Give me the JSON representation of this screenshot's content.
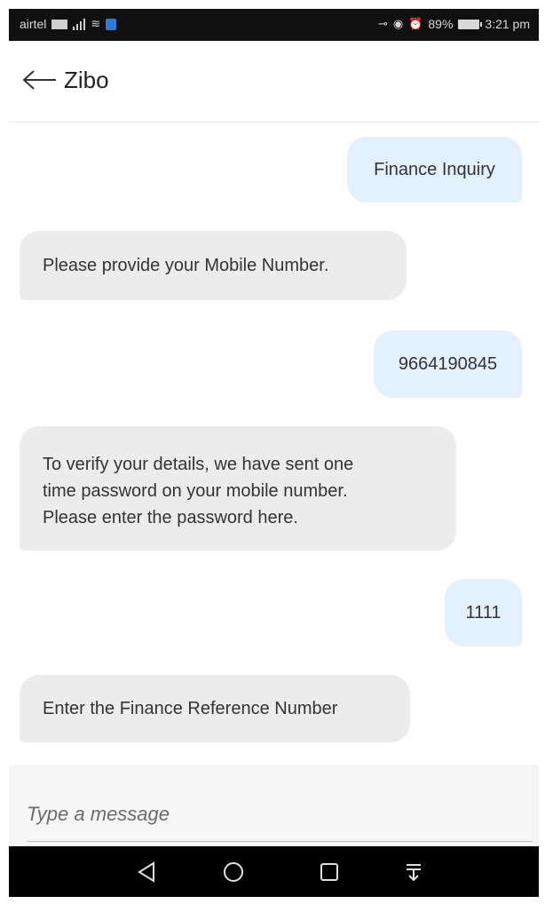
{
  "status_bar": {
    "carrier": "airtel",
    "battery": "89%",
    "time": "3:21 pm",
    "icons": [
      "sim-card-icon",
      "signal-icon",
      "wifi-icon",
      "shield-icon",
      "key-icon",
      "eye-icon",
      "alarm-icon",
      "battery-icon"
    ]
  },
  "header": {
    "title": "Zibo",
    "back_icon": "arrow-left-icon"
  },
  "messages": [
    {
      "sender": "user",
      "text": "Finance Inquiry"
    },
    {
      "sender": "bot",
      "text": "Please provide your Mobile Number."
    },
    {
      "sender": "user",
      "text": "9664190845"
    },
    {
      "sender": "bot",
      "lines": [
        "To verify your details, we have sent one",
        "time password on your mobile number.",
        "Please enter the password here."
      ]
    },
    {
      "sender": "user",
      "text": "1111"
    },
    {
      "sender": "bot",
      "text": "Enter the Finance Reference Number"
    }
  ],
  "composer": {
    "placeholder": "Type a message"
  },
  "nav_bar": {
    "buttons": [
      "back-triangle-icon",
      "home-circle-icon",
      "recents-square-icon",
      "notification-pull-icon"
    ]
  },
  "colors": {
    "user_bubble": "#e2f0ff",
    "bot_bubble": "#ececec",
    "status_bar": "#101010",
    "nav_bar": "#000000"
  }
}
